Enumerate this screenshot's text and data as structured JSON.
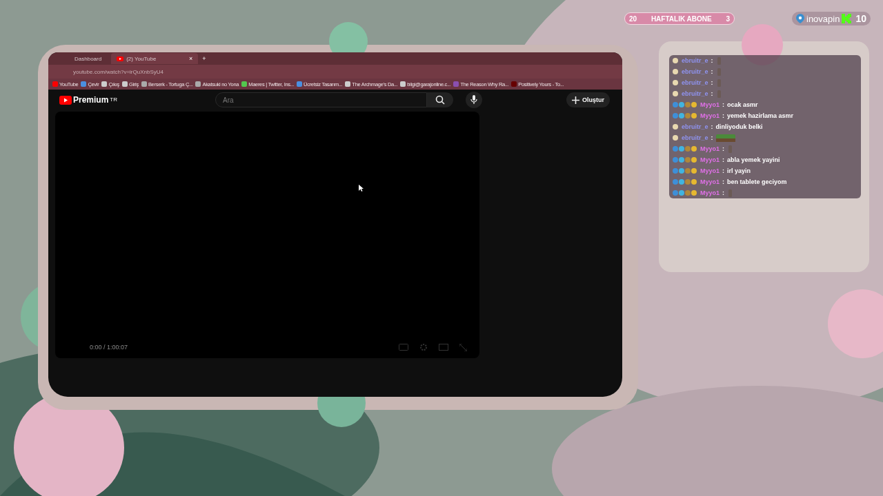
{
  "overlay": {
    "sub_goal": {
      "current": "20",
      "label": "HAFTALIK ABONE",
      "target": "3"
    },
    "sponsor": {
      "name": "inovapin"
    },
    "kick": {
      "count": "10"
    }
  },
  "browser": {
    "tabs": [
      {
        "title": "Dashboard",
        "selected": false
      },
      {
        "title": "(2) YouTube",
        "selected": true,
        "close": "×"
      }
    ],
    "new_tab": "+",
    "address": "youtube.com/watch?v=irQuXnbSyU4",
    "bookmarks": [
      "YouTube",
      "Çevir",
      "Çıkış",
      "Giriş",
      "Berserk - Tortuga Ç...",
      "Akatsuki no Yona",
      "Maeres | Twitter, Ins...",
      "Ücretsiz Tasarım...",
      "The Archmage's Da...",
      "bilgi@garajonline.c...",
      "The Reason Why Ra...",
      "Positively Yours - To..."
    ]
  },
  "youtube": {
    "logo": "Premium",
    "region": "TR",
    "search": {
      "placeholder": "Ara"
    },
    "create": "Oluştur",
    "player": {
      "time": "0:00 / 1:00:07"
    }
  },
  "chat": {
    "messages": [
      {
        "user": "ebruitr_e",
        "color": "#8f93f0",
        "subscriber": false,
        "separator": ":",
        "kind": "emote"
      },
      {
        "user": "ebruitr_e",
        "color": "#8f93f0",
        "subscriber": false,
        "separator": ":",
        "kind": "emote"
      },
      {
        "user": "ebruitr_e",
        "color": "#8f93f0",
        "subscriber": false,
        "separator": ":",
        "kind": "emote"
      },
      {
        "user": "ebruitr_e",
        "color": "#8f93f0",
        "subscriber": false,
        "separator": ":",
        "kind": "emote"
      },
      {
        "user": "Myyo1",
        "color": "#e070e8",
        "subscriber": true,
        "separator": ":",
        "kind": "text",
        "text": "ocak asmr"
      },
      {
        "user": "Myyo1",
        "color": "#e070e8",
        "subscriber": true,
        "separator": ":",
        "kind": "text",
        "text": "yemek hazirlama asmr"
      },
      {
        "user": "ebruitr_e",
        "color": "#8f93f0",
        "subscriber": false,
        "separator": ":",
        "kind": "text",
        "text": "dinliyoduk belki"
      },
      {
        "user": "ebruitr_e",
        "color": "#8f93f0",
        "subscriber": false,
        "separator": ":",
        "kind": "wide-emote"
      },
      {
        "user": "Myyo1",
        "color": "#e070e8",
        "subscriber": true,
        "separator": ":",
        "kind": "emote"
      },
      {
        "user": "Myyo1",
        "color": "#e070e8",
        "subscriber": true,
        "separator": ":",
        "kind": "text",
        "text": "abla yemek yayini"
      },
      {
        "user": "Myyo1",
        "color": "#e070e8",
        "subscriber": true,
        "separator": ":",
        "kind": "text",
        "text": "irl yayin"
      },
      {
        "user": "Myyo1",
        "color": "#e070e8",
        "subscriber": true,
        "separator": ":",
        "kind": "text",
        "text": "ben tablete geciyom"
      },
      {
        "user": "Myyo1",
        "color": "#e070e8",
        "subscriber": true,
        "separator": ":",
        "kind": "emote"
      }
    ]
  }
}
